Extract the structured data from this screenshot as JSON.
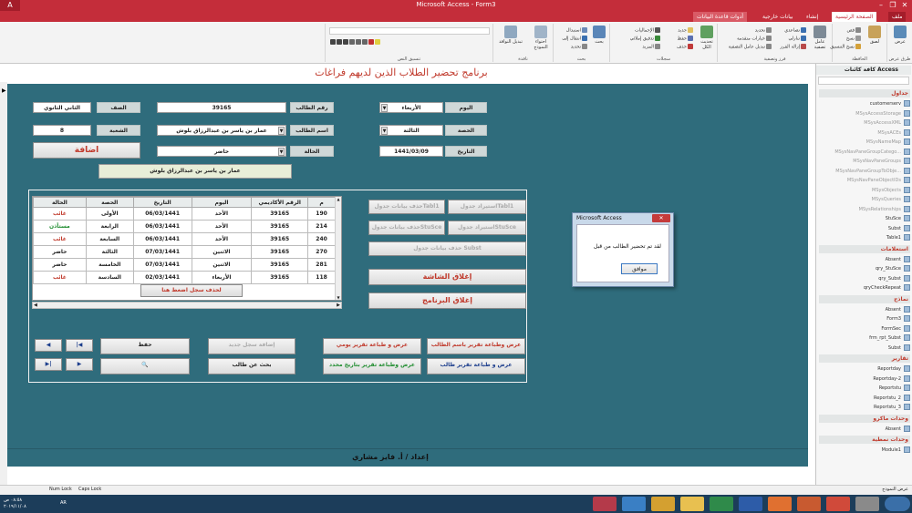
{
  "window": {
    "title": "Microsoft Access - Form3",
    "close": "✕",
    "maximize": "❐",
    "minimize": "–"
  },
  "tabs": [
    "ملف",
    "الصفحة الرئيسية",
    "إنشاء",
    "بيانات خارجية",
    "أدوات قاعدة البيانات"
  ],
  "ribbon": {
    "groups": [
      "طرق عرض",
      "الحافظة",
      "فرز وتصفية",
      "سجلات",
      "بحث",
      "نافذة",
      "تنسيق النص"
    ],
    "view_label": "عرض",
    "paste_label": "لصق",
    "cut_label": "قص",
    "copy_label": "نسخ",
    "format_painter_label": "نسخ التنسيق",
    "filter_label": "عامل تصفية",
    "ascending_label": "تصاعدي",
    "descending_label": "تنازلي",
    "remove_sort_label": "إزالة الفرز",
    "selection_label": "تحديد",
    "advanced_label": "خيارات متقدمة",
    "toggle_filter_label": "تبديل عامل التصفية",
    "refresh_label": "تحديث الكل",
    "new_label": "جديد",
    "save_label": "حفظ",
    "delete_label": "حذف",
    "totals_label": "الإجماليات",
    "spelling_label": "تدقيق إملائي",
    "more_label": "المزيد",
    "find_label": "بحث",
    "replace_label": "استبدال",
    "goto_label": "انتقال إلى",
    "select_label": "تحديد",
    "fit_label": "احتواء النموذج",
    "switch_label": "تبديل النوافذ"
  },
  "form": {
    "title": "برنامج تحضير الطلاب الذين لديهم فراغات",
    "day_label": "اليوم",
    "day_value": "الأربعاء",
    "period_label": "الحصة",
    "period_value": "الثالثة",
    "date_label": "التاريخ",
    "date_value": "1441/03/09",
    "student_no_label": "رقم الطالب",
    "student_no_value": "39165",
    "student_name_label": "اسم الطالب",
    "student_name_value": "عمار بن ياسر بن عبدالرزاق بلوش",
    "status_label": "الحالة",
    "status_value": "حاضر",
    "grade_label": "الصف",
    "grade_value": "الثاني الثانوي",
    "section_label": "الشعبة",
    "section_value": "8",
    "add_button": "اضافة",
    "name_display": "عمار بن ياسر بن عبدالرزاق بلوش",
    "author": "إعداد / أ. فايز مشاري",
    "record_marker": "▶"
  },
  "grid": {
    "columns": [
      "م",
      "الرقم الأكاديمي",
      "اليوم",
      "التاريخ",
      "الحصة",
      "الحالة"
    ],
    "rows": [
      [
        "190",
        "39165",
        "الأحد",
        "06/03/1441",
        "الأولى",
        "غائب"
      ],
      [
        "214",
        "39165",
        "الأحد",
        "06/03/1441",
        "الرابعة",
        "مستأذن"
      ],
      [
        "240",
        "39165",
        "الأحد",
        "06/03/1441",
        "السابعة",
        "غائب"
      ],
      [
        "270",
        "39165",
        "الاثنين",
        "07/03/1441",
        "الثالثة",
        "حاضر"
      ],
      [
        "281",
        "39165",
        "الاثنين",
        "07/03/1441",
        "الخامسة",
        "حاضر"
      ],
      [
        "118",
        "39165",
        "الأربعاء",
        "02/03/1441",
        "السادسة",
        "غائب"
      ]
    ],
    "delete_button": "لحذف سجل اضغط هنا",
    "scroll_up": "▲",
    "scroll_down": "▼",
    "scroll_left": "◀",
    "scroll_right": "▶"
  },
  "buttons": {
    "import_tabl1": "استيراد جدولTabl1",
    "delete_tabl1": "حذف بيانات جدولTabl1",
    "import_stusce": "استيراد جدولStuSce",
    "delete_stusce": "حذف بيانات جدولStuSce",
    "delete_subst": "حذف بيانات جدول Subst",
    "close_screen": "إغلاق الشاشة",
    "close_program": "إغلاق البرنامج",
    "report_by_name": "عرض وطباعة تقرير باسم الطالب",
    "report_daily": "عرض و طباعة تقرير يومي",
    "report_student": "عرض و طباعة تقرير طالب",
    "report_by_date": "عرض وطباعة تقرير بتاريخ محدد",
    "new_record": "إضافة سجل جديد",
    "save": "حفظ",
    "search_student": "بحث عن طالب",
    "search_glyph": "🔍",
    "nav_first": "|◀",
    "nav_prev": "◀",
    "nav_next": "▶",
    "nav_last": "▶|"
  },
  "nav_pane": {
    "title": "كافة كائنات Access",
    "sections": [
      {
        "name": "جداول",
        "items": [
          "customerserv",
          "MSysAccessStorage",
          "MSysAccessXML",
          "MSysACEs",
          "MSysNameMap",
          "MSysNavPaneGroupCatego...",
          "MSysNavPaneGroups",
          "MSysNavPaneGroupToObje...",
          "MSysNavPaneObjectIDs",
          "MSysObjects",
          "MSysQueries",
          "MSysRelationships",
          "StuSce",
          "Subst",
          "Table1"
        ]
      },
      {
        "name": "استعلامات",
        "items": [
          "Absent",
          "qry_StuSce",
          "qry_Subst",
          "qryCheckRepeat"
        ]
      },
      {
        "name": "نماذج",
        "items": [
          "Absent",
          "Form3",
          "FormSec",
          "frm_rpt_Subst",
          "Subst"
        ]
      },
      {
        "name": "تقارير",
        "items": [
          "Reportday",
          "Reportday-2",
          "Reportstu",
          "Reportstu_2",
          "Reportstu_3"
        ]
      },
      {
        "name": "وحدات ماكرو",
        "items": [
          "Absent"
        ]
      },
      {
        "name": "وحدات نمطية",
        "items": [
          "Module1"
        ]
      }
    ]
  },
  "dialog": {
    "title": "Microsoft Access",
    "message": "لقد تم تحضير الطالب من قبل",
    "ok": "موافق",
    "close": "✕"
  },
  "status": {
    "num_lock": "Num Lock",
    "caps_lock": "Caps Lock",
    "left_text": "عرض النموذج"
  },
  "taskbar": {
    "lang": "AR",
    "time": "٠٨:٥٨ ص",
    "date": "٢٠١٩/١١/٠٨"
  }
}
